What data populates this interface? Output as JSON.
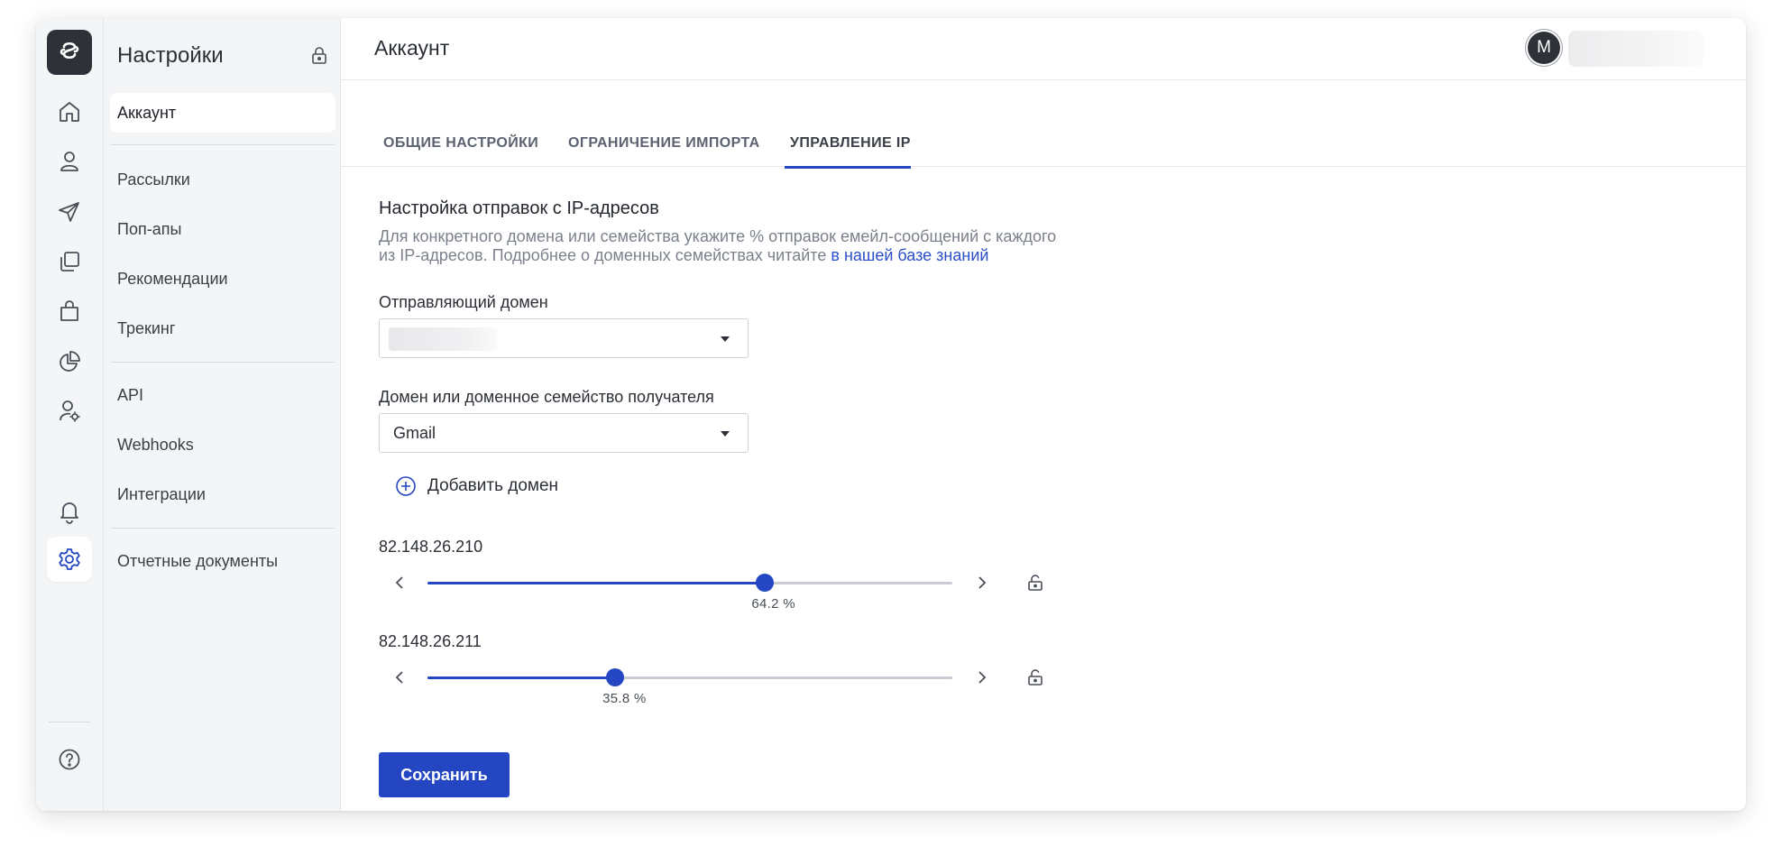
{
  "rail": {
    "items": [
      "home-icon",
      "user-icon",
      "send-icon",
      "copy-icon",
      "shopping-bag-icon",
      "pie-chart-icon",
      "user-settings-icon",
      "bell-icon",
      "gear-icon",
      "help-icon"
    ],
    "active": "gear-icon"
  },
  "sidebar": {
    "title": "Настройки",
    "items": [
      {
        "label": "Аккаунт",
        "active": true
      },
      {
        "label": "Рассылки"
      },
      {
        "label": "Поп-апы"
      },
      {
        "label": "Рекомендации"
      },
      {
        "label": "Трекинг"
      },
      {
        "label": "API"
      },
      {
        "label": "Webhooks"
      },
      {
        "label": "Интеграции"
      },
      {
        "label": "Отчетные документы"
      }
    ]
  },
  "header": {
    "title": "Аккаунт",
    "avatar_initial": "M"
  },
  "tabs": [
    {
      "label": "ОБЩИЕ НАСТРОЙКИ"
    },
    {
      "label": "ОГРАНИЧЕНИЕ ИМПОРТА"
    },
    {
      "label": "УПРАВЛЕНИЕ IP",
      "active": true
    }
  ],
  "section": {
    "title": "Настройка отправок с IP-адресов",
    "description_line1": "Для конкретного домена или семейства укажите % отправок емейл-сообщений с каждого",
    "description_line2": "из IP-адресов. Подробнее о доменных семействах читайте",
    "description_link": "в нашей базе знаний"
  },
  "form": {
    "sending_domain_label": "Отправляющий домен",
    "recipient_domain_label": "Домен или доменное семейство получателя",
    "recipient_domain_value": "Gmail",
    "add_domain_label": "Добавить домен",
    "ips": [
      {
        "address": "82.148.26.210",
        "percent_label": "64.2 %",
        "percent": 64.2
      },
      {
        "address": "82.148.26.211",
        "percent_label": "35.8 %",
        "percent": 35.8
      }
    ],
    "save_label": "Сохранить"
  },
  "colors": {
    "accent": "#2446c2",
    "link": "#2a4fc9",
    "sidebar_bg": "#f4f5f7"
  }
}
